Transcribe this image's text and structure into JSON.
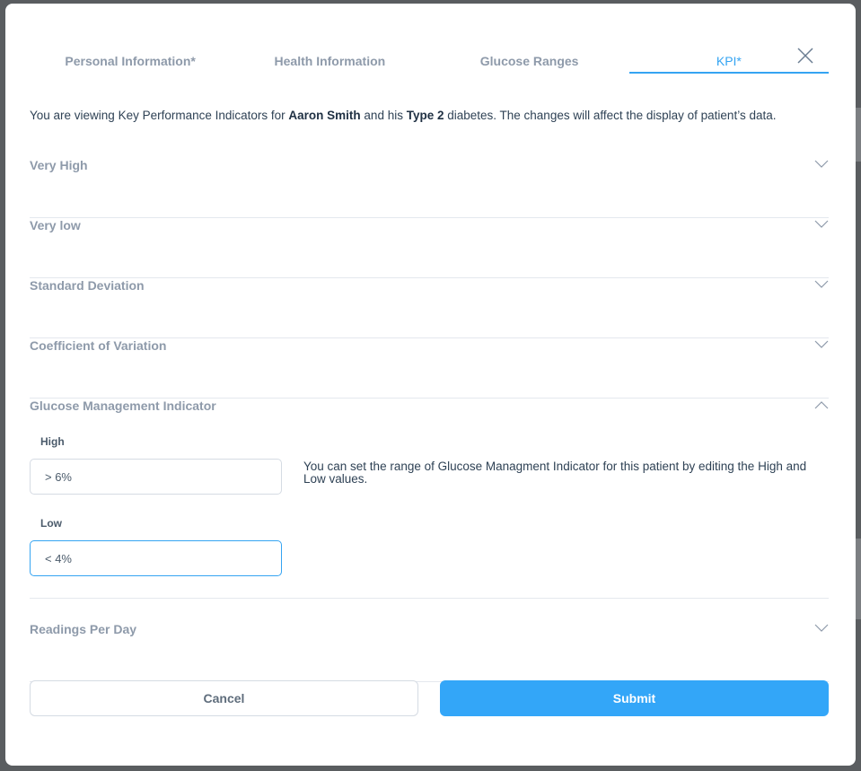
{
  "tabs": [
    {
      "label": "Personal Information*",
      "active": false
    },
    {
      "label": "Health Information",
      "active": false
    },
    {
      "label": "Glucose Ranges",
      "active": false
    },
    {
      "label": "KPI*",
      "active": true
    }
  ],
  "intro": {
    "prefix": "You are viewing Key Performance Indicators for ",
    "patient_name": "Aaron Smith",
    "middle": " and his ",
    "diabetes_type": "Type 2",
    "suffix": " diabetes. The changes will affect the display of patient’s data."
  },
  "sections": [
    {
      "label": "Very High",
      "expanded": false,
      "icon": "chevron-down-icon"
    },
    {
      "label": "Very low",
      "expanded": false,
      "icon": "chevron-down-icon"
    },
    {
      "label": "Standard Deviation",
      "expanded": false,
      "icon": "chevron-down-icon"
    },
    {
      "label": "Coefficient of Variation",
      "expanded": false,
      "icon": "chevron-down-icon"
    },
    {
      "label": "Glucose Management Indicator",
      "expanded": true,
      "icon": "chevron-up-icon"
    },
    {
      "label": "Readings Per Day",
      "expanded": false,
      "icon": "chevron-down-icon"
    }
  ],
  "gmi": {
    "high_label": "High",
    "high_value": "> 6%",
    "low_label": "Low",
    "low_value": "< 4%",
    "help_text": "You can set the range of Glucose Managment Indicator for this patient by editing the High and Low values."
  },
  "buttons": {
    "cancel": "Cancel",
    "submit": "Submit"
  },
  "colors": {
    "accent": "#35a4f2",
    "submit_bg": "#33a6f8",
    "muted_label": "#8e9aaa"
  }
}
